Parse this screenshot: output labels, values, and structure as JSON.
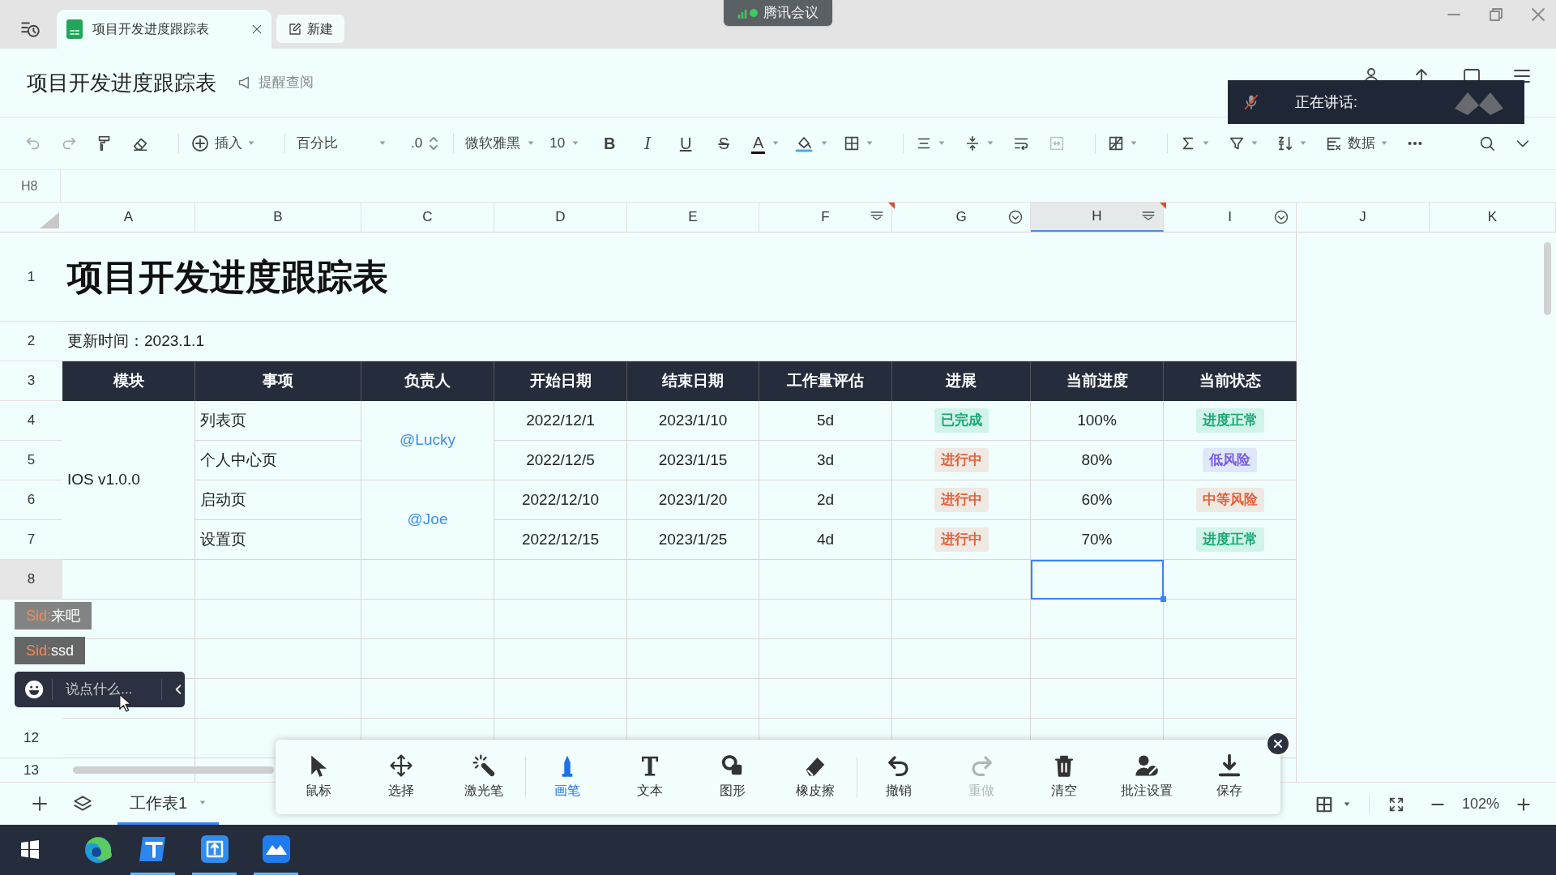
{
  "tabs": [
    {
      "label": "项目开发进度跟踪表",
      "selected": true
    }
  ],
  "new_tab": "新建",
  "meeting_badge": "腾讯会议",
  "document": {
    "title": "项目开发进度跟踪表",
    "remind": "提醒查阅"
  },
  "speaking_panel": {
    "label": "正在讲话:"
  },
  "toolbar": {
    "insert": "插入",
    "number_format": "百分比",
    "decimal": ".0",
    "font": "微软雅黑",
    "font_size": "10",
    "style_buttons": [
      "B",
      "I",
      "U",
      "S"
    ],
    "font_color": "A",
    "data": "数据"
  },
  "cell_ref": "H8",
  "columns": [
    {
      "label": "A",
      "selected": false
    },
    {
      "label": "B",
      "selected": false
    },
    {
      "label": "C",
      "selected": false
    },
    {
      "label": "D",
      "selected": false
    },
    {
      "label": "E",
      "selected": false
    },
    {
      "label": "F",
      "selected": false
    },
    {
      "label": "G",
      "selected": false
    },
    {
      "label": "H",
      "selected": true
    },
    {
      "label": "I",
      "selected": false
    },
    {
      "label": "J",
      "selected": false
    },
    {
      "label": "K",
      "selected": false
    }
  ],
  "row_numbers": [
    {
      "label": "1",
      "selected": false
    },
    {
      "label": "2",
      "selected": false
    },
    {
      "label": "3",
      "selected": false
    },
    {
      "label": "4",
      "selected": false
    },
    {
      "label": "5",
      "selected": false
    },
    {
      "label": "6",
      "selected": false
    },
    {
      "label": "7",
      "selected": false
    },
    {
      "label": "8",
      "selected": true
    },
    {
      "label": "12",
      "selected": false
    },
    {
      "label": "13",
      "selected": false
    }
  ],
  "sheet": {
    "title": "项目开发进度跟踪表",
    "updated": "更新时间：2023.1.1",
    "headers": [
      "模块",
      "事项",
      "负责人",
      "开始日期",
      "结束日期",
      "工作量评估",
      "进展",
      "当前进度",
      "当前状态"
    ],
    "module": "IOS v1.0.0",
    "owners": [
      "@Lucky",
      "@Joe"
    ],
    "tasks": [
      {
        "item": "列表页",
        "start": "2022/12/1",
        "end": "2023/1/10",
        "effort": "5d",
        "progress": {
          "text": "已完成",
          "color": "#16a870"
        },
        "percent": "100%",
        "status": {
          "text": "进度正常",
          "color": "#16a870"
        }
      },
      {
        "item": "个人中心页",
        "start": "2022/12/5",
        "end": "2023/1/15",
        "effort": "3d",
        "progress": {
          "text": "进行中",
          "color": "#e5603a"
        },
        "percent": "80%",
        "status": {
          "text": "低风险",
          "color": "#7a5ce0"
        }
      },
      {
        "item": "启动页",
        "start": "2022/12/10",
        "end": "2023/1/20",
        "effort": "2d",
        "progress": {
          "text": "进行中",
          "color": "#e5603a"
        },
        "percent": "60%",
        "status": {
          "text": "中等风险",
          "color": "#e5603a"
        }
      },
      {
        "item": "设置页",
        "start": "2022/12/15",
        "end": "2023/1/25",
        "effort": "4d",
        "progress": {
          "text": "进行中",
          "color": "#e5603a"
        },
        "percent": "70%",
        "status": {
          "text": "进度正常",
          "color": "#16a870"
        }
      }
    ]
  },
  "chat": {
    "messages": [
      {
        "sender": "Sid:",
        "text": "来吧"
      },
      {
        "sender": "Sid:",
        "text": "ssd"
      }
    ],
    "placeholder": "说点什么..."
  },
  "draw_tools": [
    {
      "label": "鼠标",
      "selected": false,
      "disabled": false
    },
    {
      "label": "选择",
      "selected": false,
      "disabled": false
    },
    {
      "label": "激光笔",
      "selected": false,
      "disabled": false
    },
    {
      "label": "画笔",
      "selected": true,
      "disabled": false
    },
    {
      "label": "文本",
      "selected": false,
      "disabled": false
    },
    {
      "label": "图形",
      "selected": false,
      "disabled": false
    },
    {
      "label": "橡皮擦",
      "selected": false,
      "disabled": false
    },
    {
      "label": "撤销",
      "selected": false,
      "disabled": false
    },
    {
      "label": "重做",
      "selected": false,
      "disabled": true
    },
    {
      "label": "清空",
      "selected": false,
      "disabled": false
    },
    {
      "label": "批注设置",
      "selected": false,
      "disabled": false
    },
    {
      "label": "保存",
      "selected": false,
      "disabled": false
    }
  ],
  "sheet_tabs": [
    {
      "label": "工作表1",
      "selected": true
    }
  ],
  "zoom": "102%"
}
